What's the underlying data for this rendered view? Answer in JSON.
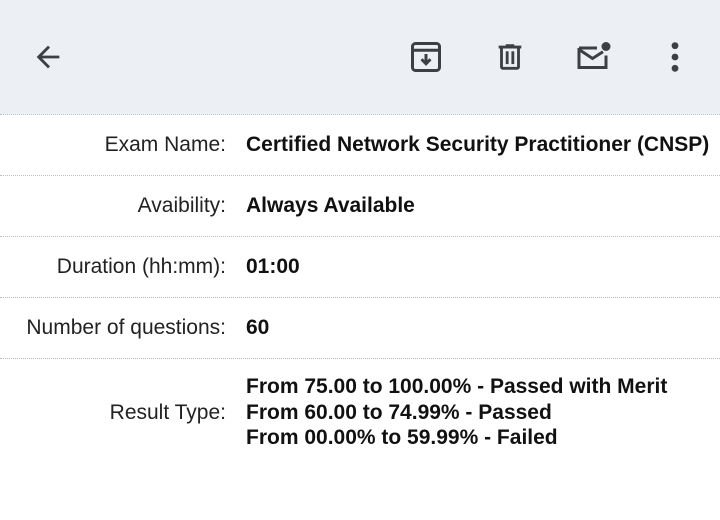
{
  "toolbar": {
    "back_icon": "arrow-left-icon",
    "archive_icon": "archive-icon",
    "delete_icon": "trash-icon",
    "mark_unread_icon": "mail-unread-icon",
    "more_icon": "more-vert-icon",
    "icon_color": "#3c4043",
    "background": "#eceff3"
  },
  "details": {
    "exam_name": {
      "label": "Exam Name:",
      "value": "Certified Network Security Practitioner (CNSP)"
    },
    "availability": {
      "label": "Avaibility:",
      "value": "Always Available"
    },
    "duration": {
      "label": "Duration (hh:mm):",
      "value": "01:00"
    },
    "questions": {
      "label": "Number of questions:",
      "value": "60"
    },
    "result_type": {
      "label": "Result Type:",
      "lines": [
        "From 75.00 to 100.00% - Passed with Merit",
        "From 60.00 to 74.99% - Passed",
        "From 00.00% to 59.99% - Failed"
      ]
    }
  }
}
